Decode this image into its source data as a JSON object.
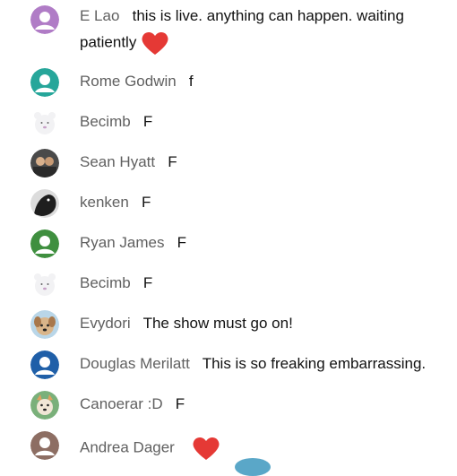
{
  "messages": [
    {
      "author": "E Lao",
      "text": "this is live. anything can happen. waiting",
      "text2": "patiently",
      "avatar_color": "#b07cc6",
      "emoji": "heart"
    },
    {
      "author": "Rome Godwin",
      "text": "f",
      "avatar_color": "#26a69a"
    },
    {
      "author": "Becimb",
      "text": "F",
      "avatar_color": "#f2f2f4"
    },
    {
      "author": "Sean Hyatt",
      "text": "F",
      "avatar_color": "#4a4a4a"
    },
    {
      "author": "kenken",
      "text": "F",
      "avatar_color": "#1e1e1e"
    },
    {
      "author": "Ryan James",
      "text": "F",
      "avatar_color": "#3f8f3f"
    },
    {
      "author": "Becimb",
      "text": "F",
      "avatar_color": "#f2f2f4"
    },
    {
      "author": "Evydori",
      "text": "The show must go on!",
      "avatar_color": "#c9a37a"
    },
    {
      "author": "Douglas Merilatt",
      "text": "This is so freaking embarrassing.",
      "avatar_color": "#1f5fa8"
    },
    {
      "author": "Canoerar :D",
      "text": "F",
      "avatar_color": "#7ab07a"
    },
    {
      "author": "Andrea Dager",
      "text": "",
      "avatar_color": "#8d6e63",
      "emoji": "heart"
    }
  ],
  "colors": {
    "author": "#606060",
    "text": "#111111",
    "heart": "#e53935"
  }
}
